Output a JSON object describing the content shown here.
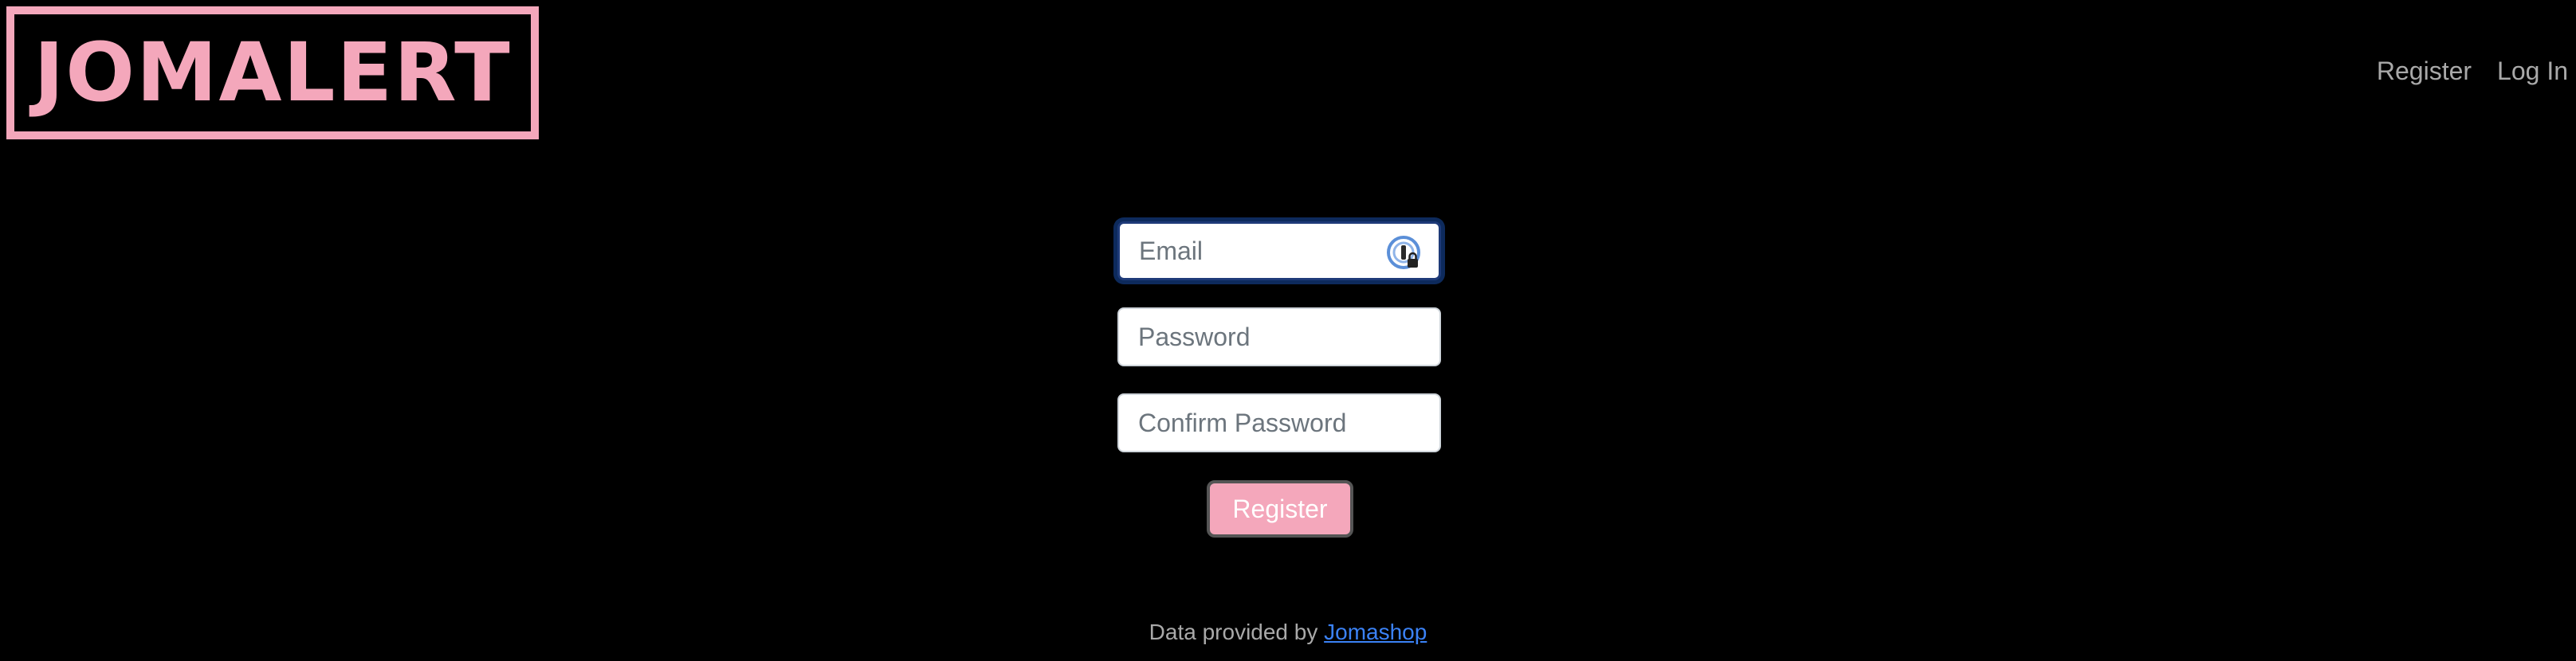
{
  "brand": {
    "logo_text": "JOMALERT",
    "color": "#f4a7bb"
  },
  "nav": {
    "register": "Register",
    "login": "Log In"
  },
  "form": {
    "email_placeholder": "Email",
    "email_value": "",
    "password_placeholder": "Password",
    "password_value": "",
    "confirm_placeholder": "Confirm Password",
    "confirm_value": "",
    "submit_label": "Register",
    "password_manager_icon": "password-manager-lock-icon"
  },
  "footer": {
    "prefix": "Data provided by",
    "link_text": "Jomashop",
    "link_color": "#3b82f6"
  }
}
